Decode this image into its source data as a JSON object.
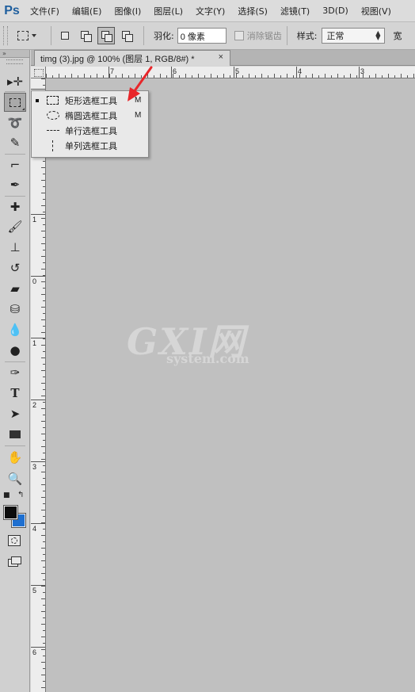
{
  "app": {
    "logo": "Ps"
  },
  "menu": [
    "文件(F)",
    "编辑(E)",
    "图像(I)",
    "图层(L)",
    "文字(Y)",
    "选择(S)",
    "滤镜(T)",
    "3D(D)",
    "视图(V)"
  ],
  "options": {
    "feather_label": "羽化:",
    "feather_value": "0 像素",
    "antialias_label": "消除锯齿",
    "style_label": "样式:",
    "style_value": "正常",
    "trailing_label": "宽"
  },
  "toolbox": {
    "collapse_label": "»"
  },
  "document": {
    "tab_title": "timg (3).jpg @ 100% (图层 1, RGB/8#) *",
    "close_glyph": "×"
  },
  "rulers": {
    "horizontal_labels": [
      "7",
      "6",
      "5",
      "4",
      "3"
    ],
    "vertical_labels": [
      "0",
      "1",
      "0",
      "1",
      "2",
      "3",
      "4",
      "5",
      "6"
    ]
  },
  "flyout": {
    "items": [
      {
        "label": "矩形选框工具",
        "shortcut": "M",
        "selected": true,
        "icon": "rect-marquee-icon"
      },
      {
        "label": "椭圆选框工具",
        "shortcut": "M",
        "selected": false,
        "icon": "ellipse-marquee-icon"
      },
      {
        "label": "单行选框工具",
        "shortcut": "",
        "selected": false,
        "icon": "single-row-marquee-icon"
      },
      {
        "label": "单列选框工具",
        "shortcut": "",
        "selected": false,
        "icon": "single-column-marquee-icon"
      }
    ]
  },
  "watermark": {
    "main": "GXI网",
    "sub": "system.com"
  },
  "colors": {
    "foreground": "#0c0c0c",
    "background": "#1e6fd0",
    "canvas": "#c0c0c0",
    "arrow": "#e8262a"
  }
}
